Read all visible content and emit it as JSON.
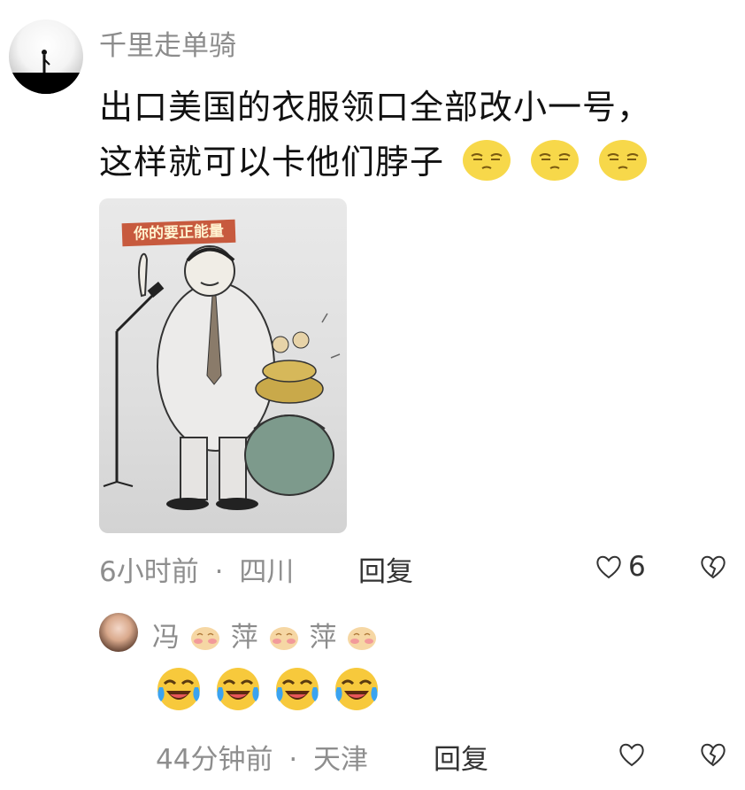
{
  "comment": {
    "username": "千里走单骑",
    "text_line1": "出口美国的衣服领口全部改小一号，",
    "text_line2": "这样就可以卡他们脖子",
    "emojis": [
      "smirk-face",
      "smirk-face",
      "smirk-face"
    ],
    "image_caption": "你的要正能量",
    "time": "6小时前",
    "separator": "·",
    "location": "四川",
    "reply_label": "回复",
    "like_count": "6"
  },
  "reply": {
    "username_parts": [
      "冯",
      "萍",
      "萍"
    ],
    "emojis": [
      "laughing-tears-face",
      "laughing-tears-face",
      "laughing-tears-face",
      "laughing-tears-face"
    ],
    "time": "44分钟前",
    "separator": "·",
    "location": "天津",
    "reply_label": "回复"
  },
  "colors": {
    "muted": "#8e8e8e",
    "text": "#111111",
    "emoji_yellow": "#f7d84a"
  }
}
